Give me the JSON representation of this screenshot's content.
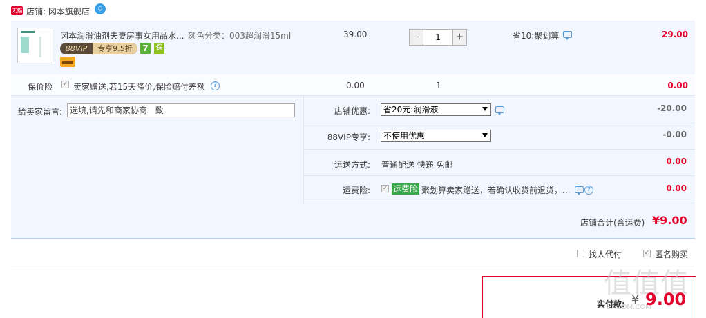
{
  "shop": {
    "tmall_logo": "天猫",
    "label": "店铺: 冈本旗舰店",
    "ww_icon": "wangwang-chat-icon"
  },
  "item": {
    "title": "冈本润滑油剂夫妻房事女用品水...",
    "sku": "颜色分类：003超润滑15ml",
    "vip_left": "88VIP",
    "vip_right": "专享9.5折",
    "badge_7": "7",
    "badge_g": "保",
    "unit_price": "39.00",
    "qty_minus": "-",
    "quantity": "1",
    "qty_plus": "+",
    "promo": "省10:聚划算",
    "total": "29.00"
  },
  "insurance": {
    "label": "保价险",
    "checked": "✓",
    "text": "卖家赠送,若15天降价,保险赔付差额",
    "help": "?",
    "price": "0.00",
    "qty": "1",
    "total": "0.00"
  },
  "message": {
    "label": "给卖家留言:",
    "placeholder": "选填,请先和商家协商一致"
  },
  "options": {
    "shop_discount_label": "店铺优惠:",
    "shop_discount_value": "省20元:润滑液",
    "shop_discount_amount": "-20.00",
    "vip_label": "88VIP专享:",
    "vip_value": "不使用优惠",
    "vip_amount": "-0.00",
    "ship_label": "运送方式:",
    "ship_text": "普通配送 快递 免邮",
    "ship_amount": "0.00",
    "freight_label": "运费险:",
    "freight_checked": "✓",
    "freight_badge": "运费险",
    "freight_text": "聚划算卖家赠送，若确认收货前退货，...",
    "freight_help": "?",
    "freight_amount": "0.00"
  },
  "shop_total": {
    "label": "店铺合计(含运费)",
    "value": "¥9.00"
  },
  "bottom": {
    "pay_for_me": "找人代付",
    "anonymous": "匿名购买",
    "anonymous_checked": "✓",
    "pay_label": "实付款:",
    "pay_yen": "¥",
    "pay_amount": "9.00"
  },
  "watermark": {
    "main": "值值值",
    "sub": "SMZDM.COM"
  },
  "colors": {
    "accent_red": "#e4002b",
    "blue_border": "#b2d1ff",
    "panel_bg": "#f2f7ff",
    "green_badge": "#3aa84a"
  }
}
